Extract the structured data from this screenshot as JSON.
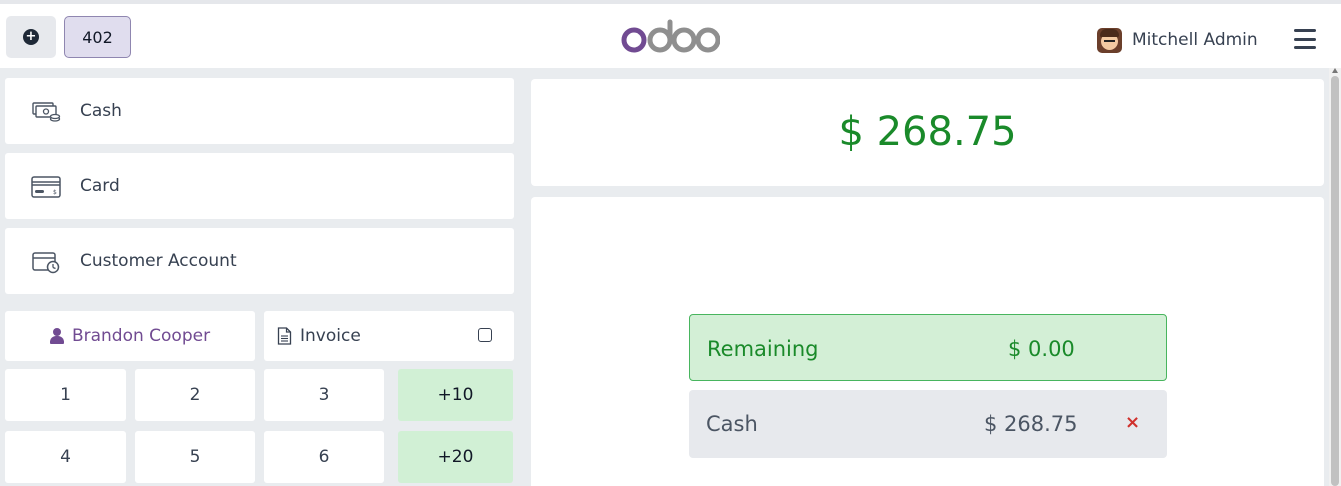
{
  "header": {
    "new_order_icon": "plus-circle-icon",
    "order_number": "402",
    "logo_text": "odoo",
    "user_name": "Mitchell Admin",
    "menu_icon": "hamburger-menu-icon"
  },
  "payment_methods": [
    {
      "label": "Cash",
      "icon": "cash-icon"
    },
    {
      "label": "Card",
      "icon": "card-icon"
    },
    {
      "label": "Customer Account",
      "icon": "customer-account-icon"
    }
  ],
  "controls": {
    "customer_label": "Brandon Cooper",
    "invoice_label": "Invoice",
    "invoice_checked": false
  },
  "keypad": {
    "row1": [
      "1",
      "2",
      "3",
      "+10"
    ],
    "row2": [
      "4",
      "5",
      "6",
      "+20"
    ]
  },
  "summary": {
    "total": "$ 268.75",
    "remaining_label": "Remaining",
    "remaining_amount": "$ 0.00",
    "payment_line_label": "Cash",
    "payment_line_amount": "$ 268.75",
    "delete_icon": "×"
  },
  "colors": {
    "brand": "#714b92",
    "success": "#1a8a2a",
    "quick_add_bg": "#d1f0d5",
    "danger": "#d0312d"
  }
}
